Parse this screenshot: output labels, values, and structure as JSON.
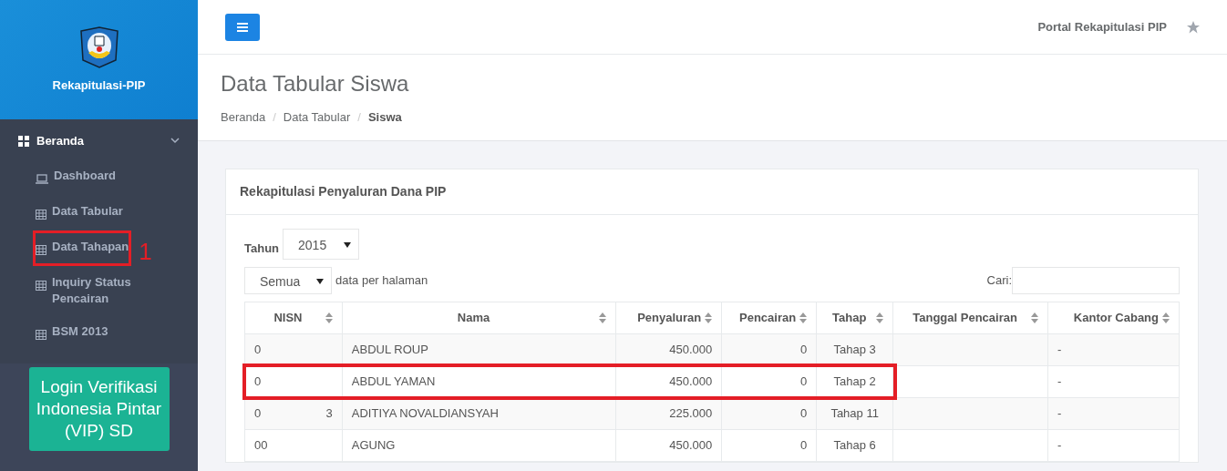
{
  "sidebar": {
    "brand": "Rekapitulasi-PIP",
    "menu": {
      "label": "Beranda",
      "expanded": true,
      "children": [
        {
          "label": "Dashboard",
          "kind": "laptop",
          "highlighted": false
        },
        {
          "label": "Data Tabular",
          "kind": "table",
          "highlighted": false
        },
        {
          "label": "Data Tahapan",
          "kind": "table",
          "highlighted": true,
          "callout": "1"
        },
        {
          "label": "Inquiry Status Pencairan",
          "kind": "table",
          "highlighted": false
        },
        {
          "label": "BSM 2013",
          "kind": "table",
          "highlighted": false
        }
      ]
    },
    "login_button": "Login Verifikasi Indonesia Pintar (VIP) SD"
  },
  "topbar": {
    "title": "Portal Rekapitulasi PIP"
  },
  "page": {
    "title": "Data Tabular Siswa",
    "separator": "/",
    "breadcrumb": [
      {
        "label": "Beranda",
        "active": false
      },
      {
        "label": "Data Tabular",
        "active": false
      },
      {
        "label": "Siswa",
        "active": true
      }
    ]
  },
  "card": {
    "title": "Rekapitulasi Penyaluran Dana PIP",
    "year": {
      "label": "Tahun",
      "value": "2015"
    },
    "page_size": {
      "value": "Semua",
      "suffix": "data per halaman"
    },
    "search": {
      "label": "Cari:"
    },
    "table": {
      "columns": [
        {
          "label": "NISN"
        },
        {
          "label": "Nama"
        },
        {
          "label": "Penyaluran"
        },
        {
          "label": "Pencairan"
        },
        {
          "label": "Tahap"
        },
        {
          "label": "Tanggal Pencairan"
        },
        {
          "label": "Kantor Cabang"
        }
      ],
      "rows": [
        {
          "nisn": "0",
          "nama": "ABDUL ROUP",
          "penyaluran": "450.000",
          "pencairan": "0",
          "tahap": "Tahap 3",
          "kantor": "-",
          "highlighted": false
        },
        {
          "nisn": "0",
          "nama": "ABDUL YAMAN",
          "penyaluran": "450.000",
          "pencairan": "0",
          "tahap": "Tahap 2",
          "kantor": "-",
          "highlighted": true
        },
        {
          "nisn": "0",
          "nisn_end": "3",
          "nama": "ADITIYA NOVALDIANSYAH",
          "penyaluran": "225.000",
          "pencairan": "0",
          "tahap": "Tahap 11",
          "kantor": "-",
          "highlighted": false
        },
        {
          "nisn": "00",
          "nama": "AGUNG",
          "penyaluran": "450.000",
          "pencairan": "0",
          "tahap": "Tahap 6",
          "kantor": "-",
          "highlighted": false
        }
      ]
    }
  }
}
